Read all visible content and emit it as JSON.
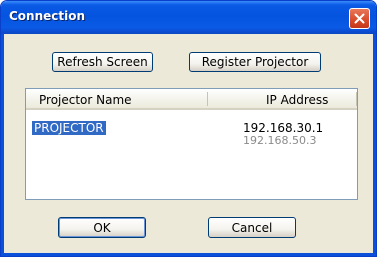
{
  "window": {
    "title": "Connection"
  },
  "toolbar": {
    "refresh_label": "Refresh Screen",
    "register_label": "Register Projector"
  },
  "list": {
    "columns": [
      "Projector Name",
      "IP Address"
    ],
    "rows": [
      {
        "name": "PROJECTOR",
        "ip_addresses": [
          "192.168.30.1",
          "192.168.50.3"
        ],
        "selected": true
      }
    ]
  },
  "footer": {
    "ok_label": "OK",
    "cancel_label": "Cancel"
  },
  "icons": {
    "close": "close-icon"
  },
  "colors": {
    "titlebar": "#0554e0",
    "selection": "#316ac5",
    "close_button": "#d74a2a"
  }
}
